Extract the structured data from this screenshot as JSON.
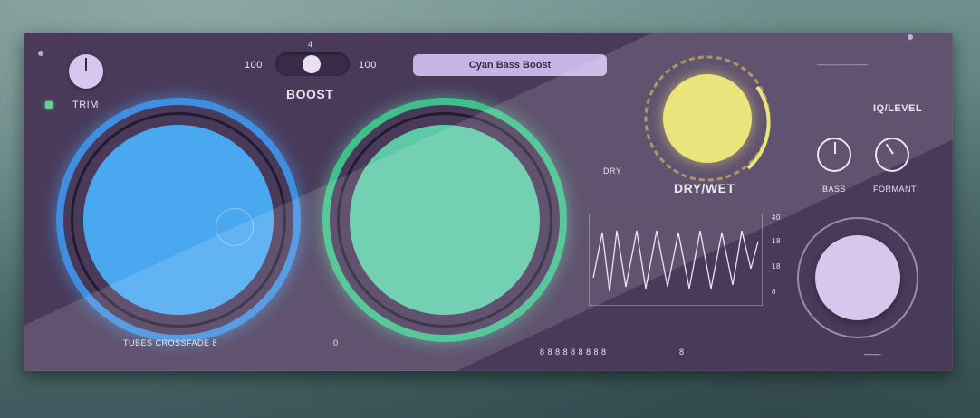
{
  "controls": {
    "trim_label": "TRIM",
    "boost_label": "BOOST",
    "boost_min": "100",
    "boost_max": "100",
    "boost_top_marker": "4",
    "preset_name": "Cyan Bass Boost",
    "drywet_label": "DRY/WET",
    "right_header": "IQ/LEVEL",
    "mini_knob_1_label": "BASS",
    "mini_knob_2_label": "FORMANT",
    "top_right_readout": "——————",
    "drywet_side_label": "DRY"
  },
  "scope": {
    "tick_labels": [
      "40",
      "18",
      "18",
      "8"
    ]
  },
  "bottom": {
    "left_status": "TUBES CROSSFADE 8",
    "mid_left": "0",
    "center_status": "8 8 8 8 8 8 8 8 8",
    "mid_right": "8",
    "right_status": "——"
  },
  "colors": {
    "panel": "#4a3a5a",
    "blue_disc": "#4aa8f0",
    "green_disc": "#5ec9a6",
    "yellow_knob": "#e7e06a",
    "lavender_knob": "#d9c6ef"
  }
}
